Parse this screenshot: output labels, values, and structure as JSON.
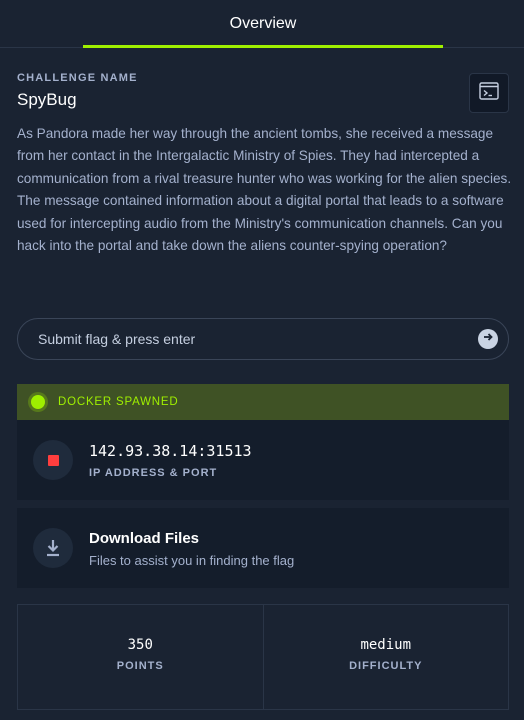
{
  "tabs": [
    {
      "label": "Overview",
      "active": true
    }
  ],
  "challenge": {
    "label": "CHALLENGE NAME",
    "name": "SpyBug",
    "description": "As Pandora made her way through the ancient tombs, she received a message from her contact in the Intergalactic Ministry of Spies. They had intercepted a communication from a rival treasure hunter who was working for the alien species. The message contained information about a digital portal that leads to a software used for intercepting audio from the Ministry's communication channels. Can you hack into the portal and take down the aliens counter-spying operation?"
  },
  "flag": {
    "placeholder": "Submit flag & press enter",
    "value": ""
  },
  "docker": {
    "status": "DOCKER SPAWNED",
    "status_color": "#9fef00"
  },
  "instance": {
    "ip_port": "142.93.38.14:31513",
    "label": "IP ADDRESS & PORT"
  },
  "download": {
    "title": "Download Files",
    "subtitle": "Files to assist you in finding the flag"
  },
  "stats": [
    {
      "value": "350",
      "label": "POINTS"
    },
    {
      "value": "medium",
      "label": "DIFFICULTY"
    }
  ],
  "icons": {
    "terminal": "terminal-icon",
    "submit": "arrow-right-circle-icon",
    "stop": "stop-icon",
    "download": "download-icon",
    "status": "status-dot-icon"
  },
  "colors": {
    "accent": "#9fef00",
    "background": "#1a2332",
    "stop": "#ff3e3e",
    "docker_bar": "#3f5225"
  }
}
